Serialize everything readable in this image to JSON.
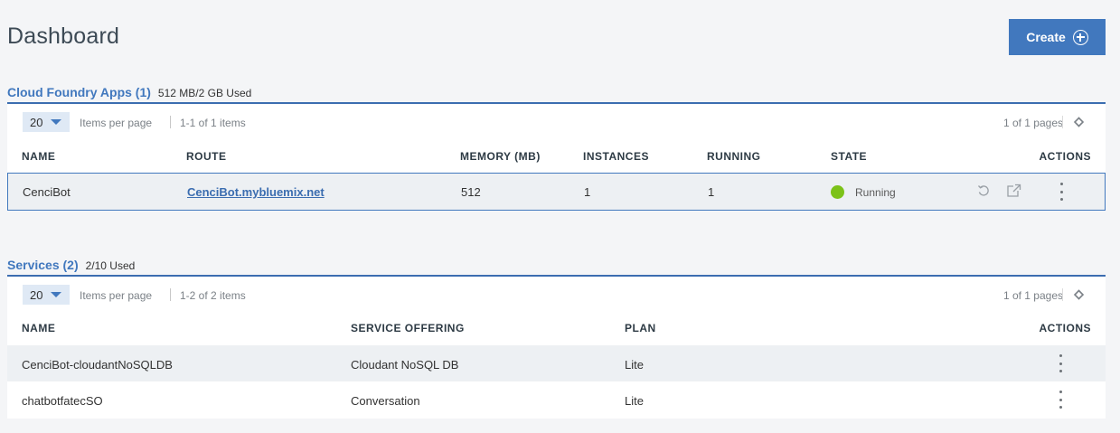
{
  "page": {
    "title": "Dashboard"
  },
  "header": {
    "create_label": "Create"
  },
  "apps": {
    "title": "Cloud Foundry Apps (1)",
    "usage": "512 MB/2 GB Used",
    "per_page_value": "20",
    "items_per_page_label": "Items per page",
    "range_text": "1-1 of 1 items",
    "pages_text": "1 of 1 pages",
    "columns": [
      "NAME",
      "ROUTE",
      "MEMORY (MB)",
      "INSTANCES",
      "RUNNING",
      "STATE",
      "ACTIONS"
    ],
    "rows": [
      {
        "name": "CenciBot",
        "route": "CenciBot.mybluemix.net",
        "memory": "512",
        "instances": "1",
        "running": "1",
        "state": "Running",
        "state_color": "#7cc219"
      }
    ]
  },
  "services": {
    "title": "Services (2)",
    "usage": "2/10 Used",
    "per_page_value": "20",
    "items_per_page_label": "Items per page",
    "range_text": "1-2 of 2 items",
    "pages_text": "1 of 1 pages",
    "columns": [
      "NAME",
      "SERVICE OFFERING",
      "PLAN",
      "ACTIONS"
    ],
    "rows": [
      {
        "name": "CenciBot-cloudantNoSQLDB",
        "offering": "Cloudant NoSQL DB",
        "plan": "Lite"
      },
      {
        "name": "chatbotfatecSO",
        "offering": "Conversation",
        "plan": "Lite"
      }
    ]
  },
  "icons": {
    "create": "plus-circle-icon",
    "per_page_caret": "caret-down-icon",
    "prev_page": "chevron-left-icon",
    "next_page": "chevron-right-icon",
    "restart": "restart-icon",
    "launch": "launch-icon",
    "overflow": "overflow-menu-icon"
  },
  "colors": {
    "accent": "#4178be",
    "running": "#7cc219",
    "row_highlight": "#edf0f3"
  }
}
